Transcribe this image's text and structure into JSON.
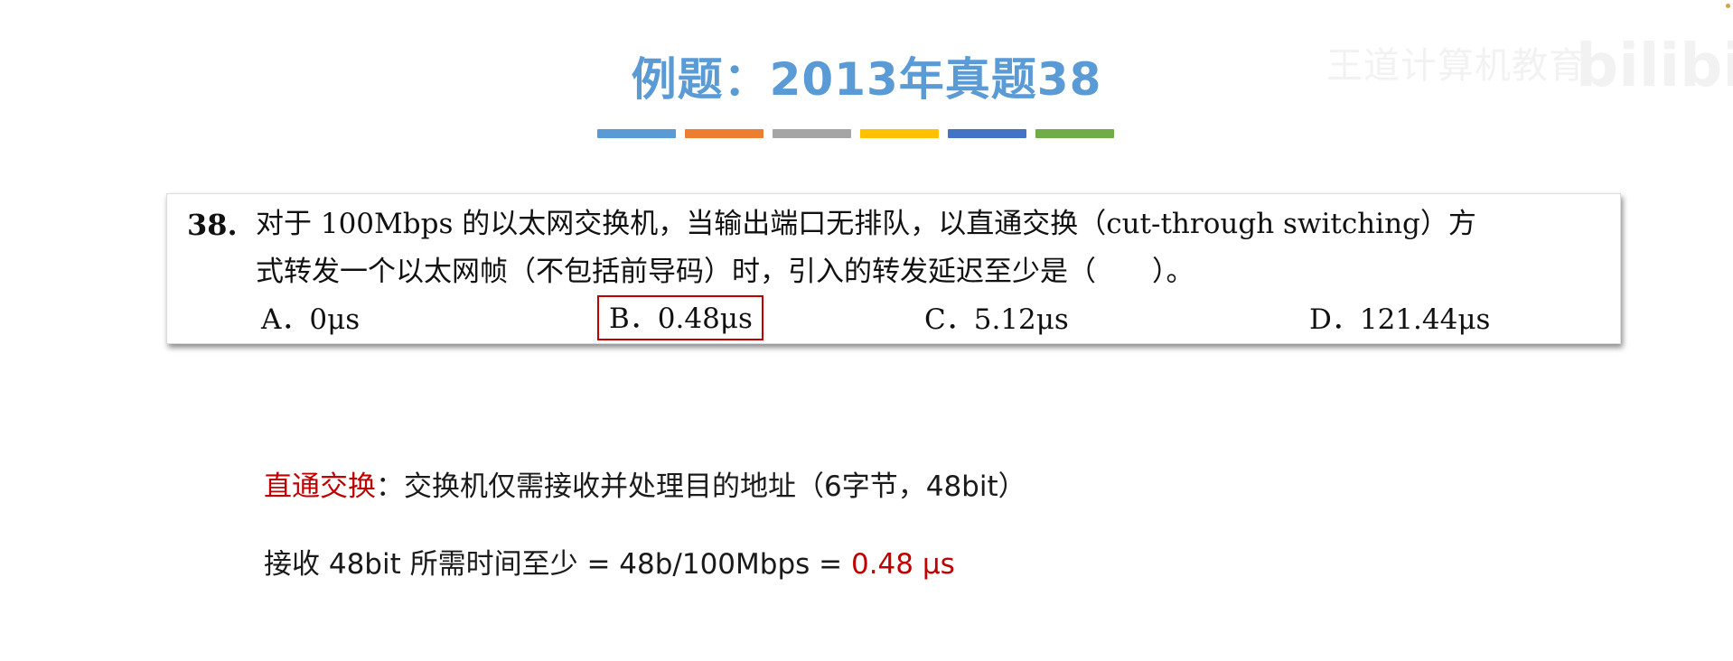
{
  "slide": {
    "title": "例题：2013年真题38",
    "decor_bar_colors": [
      "#5b9bd5",
      "#ed7d31",
      "#a5a5a5",
      "#ffc000",
      "#4472c4",
      "#70ad47"
    ]
  },
  "watermark": {
    "text": "王道计算机教育",
    "logo": "bilibili"
  },
  "question": {
    "number": "38.",
    "line1": "对于 100Mbps 的以太网交换机，当输出端口无排队，以直通交换（cut-through switching）方",
    "line2": "式转发一个以太网帧（不包括前导码）时，引入的转发延迟至少是（　　）。",
    "options": {
      "a": "A．0μs",
      "b": "B．0.48μs",
      "c": "C．5.12μs",
      "d": "D．121.44μs"
    },
    "highlighted_option": "B"
  },
  "explanation": {
    "term": "直通交换",
    "line1_rest": "：交换机仅需接收并处理目的地址（6字节，48bit）",
    "line2_prefix": "接收 48bit 所需时间至少 = 48b/100Mbps = ",
    "line2_result": "0.48 μs"
  },
  "colors": {
    "title": "#5b9bd5",
    "highlight_red": "#c00000"
  }
}
